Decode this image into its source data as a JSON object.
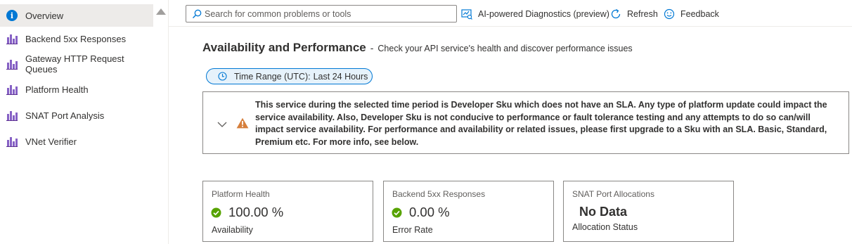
{
  "sidebar": {
    "items": [
      {
        "label": "Overview",
        "icon": "info-icon",
        "active": true
      },
      {
        "label": "Backend 5xx Responses",
        "icon": "chart-icon"
      },
      {
        "label": "Gateway HTTP Request Queues",
        "icon": "chart-icon"
      },
      {
        "label": "Platform Health",
        "icon": "chart-icon"
      },
      {
        "label": "SNAT Port Analysis",
        "icon": "chart-icon"
      },
      {
        "label": "VNet Verifier",
        "icon": "chart-icon"
      }
    ]
  },
  "toolbar": {
    "search_placeholder": "Search for common problems or tools",
    "ai_diagnostics_label": "AI-powered Diagnostics (preview)",
    "refresh_label": "Refresh",
    "feedback_label": "Feedback"
  },
  "main": {
    "title": "Availability and Performance",
    "title_separator": "-",
    "subtitle": "Check your API service's health and discover performance issues",
    "time_range": {
      "label": "Time Range (UTC):",
      "value": "Last 24 Hours"
    },
    "warning": {
      "text": "This service during the selected time period is Developer Sku which does not have an SLA. Any type of platform update could impact the service availability. Also, Developer Sku is not conducive to performance or fault tolerance testing and any attempts to do so can/will impact service availability. For performance and availability or related issues, please first upgrade to a Sku with an SLA. Basic, Standard, Premium etc. For more info, see below."
    },
    "cards": [
      {
        "header": "Platform Health",
        "value": "100.00 %",
        "footer": "Availability",
        "status": "ok"
      },
      {
        "header": "Backend 5xx Responses",
        "value": "0.00 %",
        "footer": "Error Rate",
        "status": "ok"
      },
      {
        "header": "SNAT Port Allocations",
        "value": "No Data",
        "footer": "Allocation Status",
        "status": "none"
      }
    ]
  },
  "colors": {
    "accent": "#0078d4",
    "success": "#57a300",
    "warning": "#d67f3c",
    "chart_icon": "#8661c5"
  }
}
